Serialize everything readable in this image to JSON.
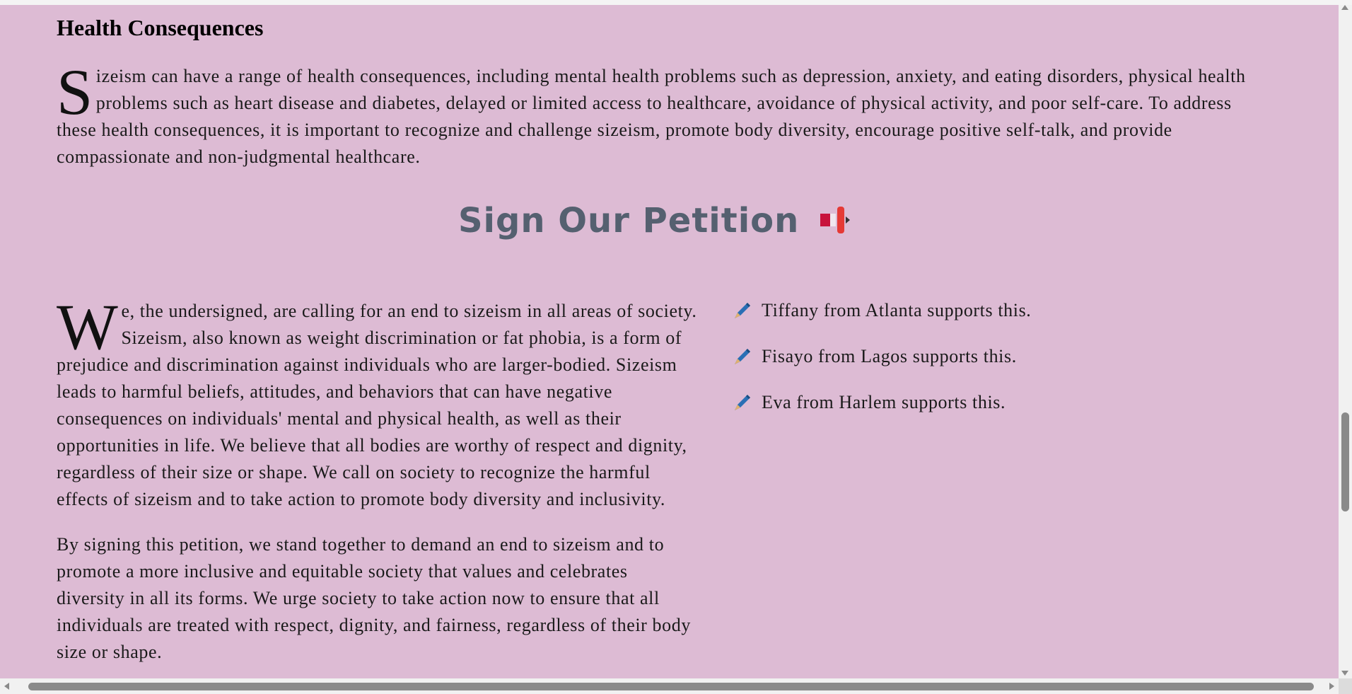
{
  "health": {
    "heading": "Health Consequences",
    "dropcap": "S",
    "text": "izeism can have a range of health consequences, including mental health problems such as depression, anxiety, and eating disorders, physical health problems such as heart disease and diabetes, delayed or limited access to healthcare, avoidance of physical activity, and poor self-care. To address these health consequences, it is important to recognize and challenge sizeism, promote body diversity, encourage positive self-talk, and provide compassionate and non-judgmental healthcare."
  },
  "petition": {
    "title": "Sign Our Petition",
    "title_icon": "petition-flag-icon",
    "statement": {
      "dropcap": "W",
      "paragraph1": "e, the undersigned, are calling for an end to sizeism in all areas of society. Sizeism, also known as weight discrimination or fat phobia, is a form of prejudice and discrimination against individuals who are larger-bodied. Sizeism leads to harmful beliefs, attitudes, and behaviors that can have negative consequences on individuals' mental and physical health, as well as their opportunities in life. We believe that all bodies are worthy of respect and dignity, regardless of their size or shape. We call on society to recognize the harmful effects of sizeism and to take action to promote body diversity and inclusivity.",
      "paragraph2": "By signing this petition, we stand together to demand an end to sizeism and to promote a more inclusive and equitable society that values and celebrates diversity in all its forms. We urge society to take action now to ensure that all individuals are treated with respect, dignity, and fairness, regardless of their body size or shape."
    },
    "supporters": [
      {
        "icon": "pen-icon",
        "text": "Tiffany from Atlanta supports this."
      },
      {
        "icon": "pen-icon",
        "text": "Fisayo from Lagos supports this."
      },
      {
        "icon": "pen-icon",
        "text": "Eva from Harlem supports this."
      }
    ]
  },
  "colors": {
    "background": "#ddbbd4",
    "title": "#556070",
    "pen": "#2a6fb5"
  }
}
